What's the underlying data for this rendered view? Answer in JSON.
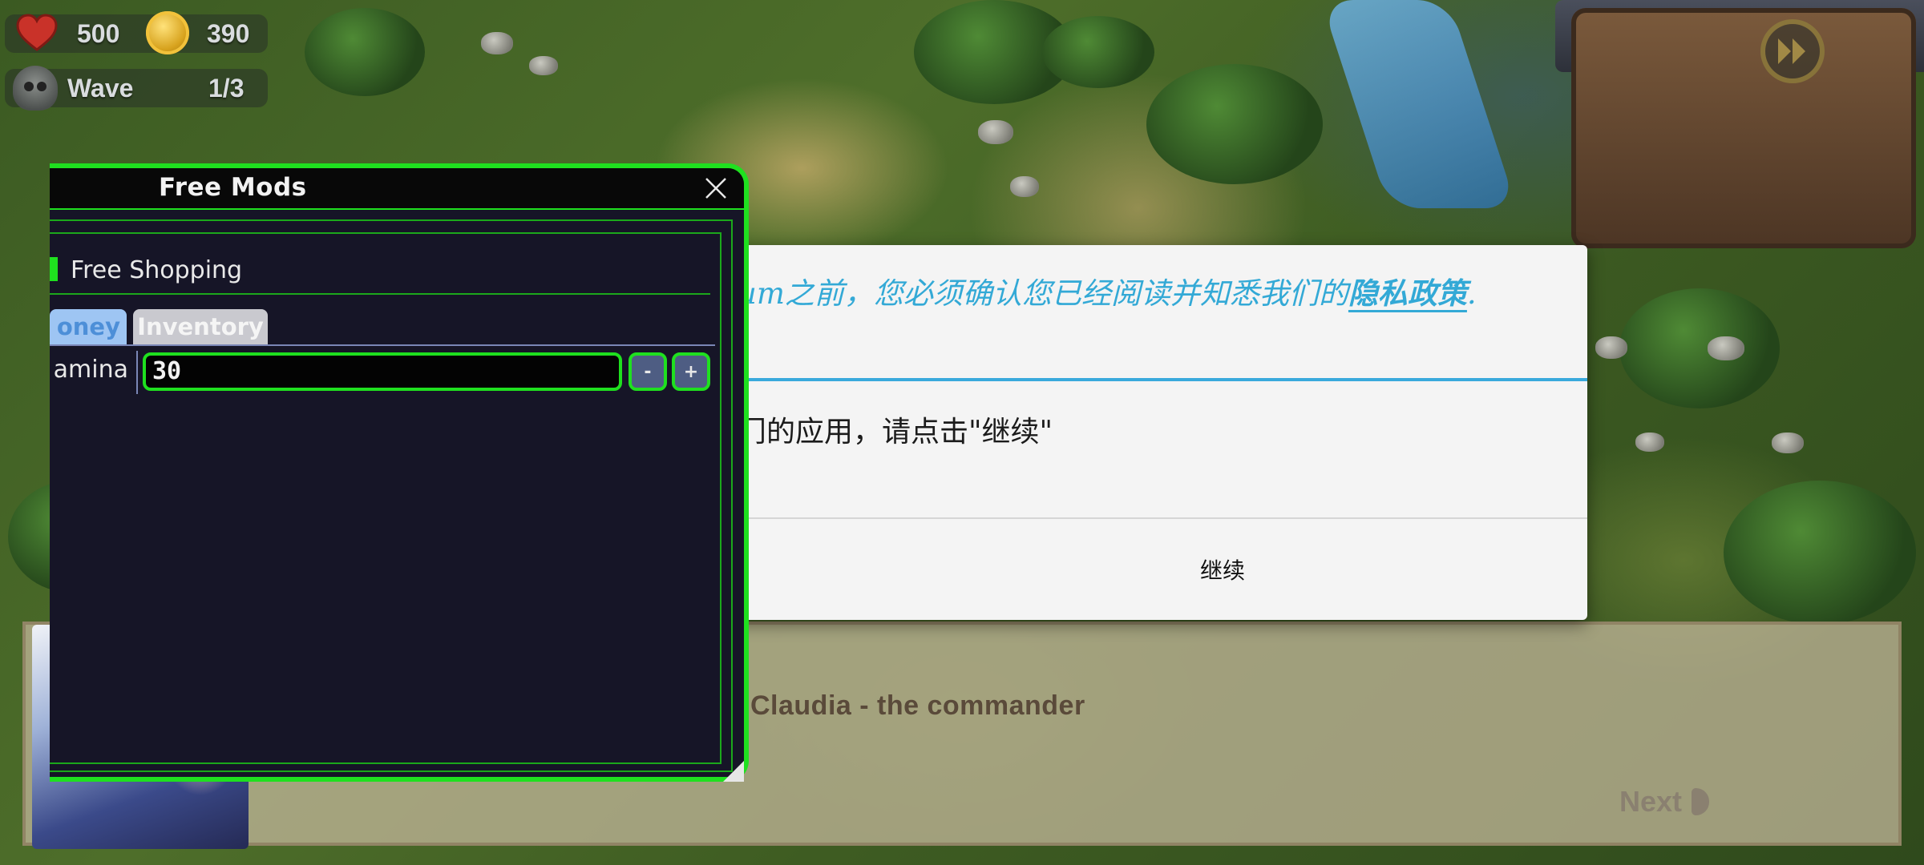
{
  "hud": {
    "lives": "500",
    "gold": "390",
    "wave_label": "Wave",
    "wave_value": "1/3"
  },
  "privacy": {
    "text_prefix": "um之前，您必须确认您已经阅读并知悉我们的",
    "policy_link": "隐私政策",
    "text_suffix": ".",
    "body": "门的应用，请点击\"继续\"",
    "continue_label": "继续",
    "accent_color": "#39a9dc"
  },
  "dialog": {
    "speaker": "Claudia - the commander",
    "next_label": "Next"
  },
  "mod_menu": {
    "title": "Free Mods",
    "toggle_label": "Free Shopping",
    "tabs": [
      {
        "label": "oney"
      },
      {
        "label": "Inventory"
      }
    ],
    "field_label": "amina",
    "field_value": "30",
    "minus_label": "-",
    "plus_label": "+",
    "accent_color": "#1fe01f"
  },
  "icons": [
    "heart-icon",
    "coin-icon",
    "skull-icon",
    "fast-forward-icon",
    "close-icon",
    "next-arrow-icon",
    "resize-handle-icon"
  ]
}
